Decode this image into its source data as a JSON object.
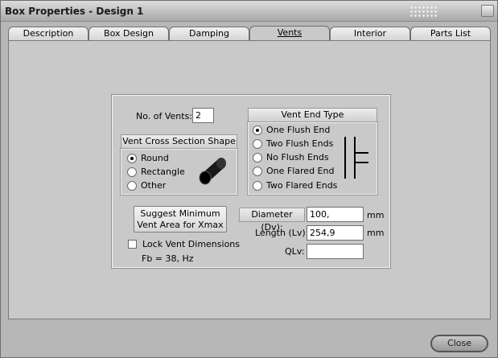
{
  "window": {
    "title": "Box Properties - Design 1"
  },
  "tabs": [
    {
      "label": "Description"
    },
    {
      "label": "Box Design"
    },
    {
      "label": "Damping"
    },
    {
      "label": "Vents",
      "active": true
    },
    {
      "label": "Interior"
    },
    {
      "label": "Parts List"
    }
  ],
  "vents": {
    "count_label": "No. of Vents:",
    "count_value": "2",
    "cross_section": {
      "title": "Vent Cross Section Shape",
      "options": [
        "Round",
        "Rectangle",
        "Other"
      ],
      "selected": "Round"
    },
    "end_type": {
      "title": "Vent End Type",
      "options": [
        "One Flush End",
        "Two Flush Ends",
        "No Flush Ends",
        "One Flared End",
        "Two Flared Ends"
      ],
      "selected": "One Flush End"
    },
    "suggest_button": {
      "line1": "Suggest Minimum",
      "line2": "Vent Area for Xmax"
    },
    "lock_label": "Lock Vent Dimensions",
    "lock_checked": false,
    "fb_text": "Fb = 38, Hz",
    "diameter": {
      "label": "Diameter (Dv):",
      "value": "100,",
      "unit": "mm"
    },
    "length": {
      "label": "Length (Lv):",
      "value": "254,9",
      "unit": "mm"
    },
    "qlv": {
      "label": "QLv:",
      "value": ""
    }
  },
  "footer": {
    "close_label": "Close"
  }
}
